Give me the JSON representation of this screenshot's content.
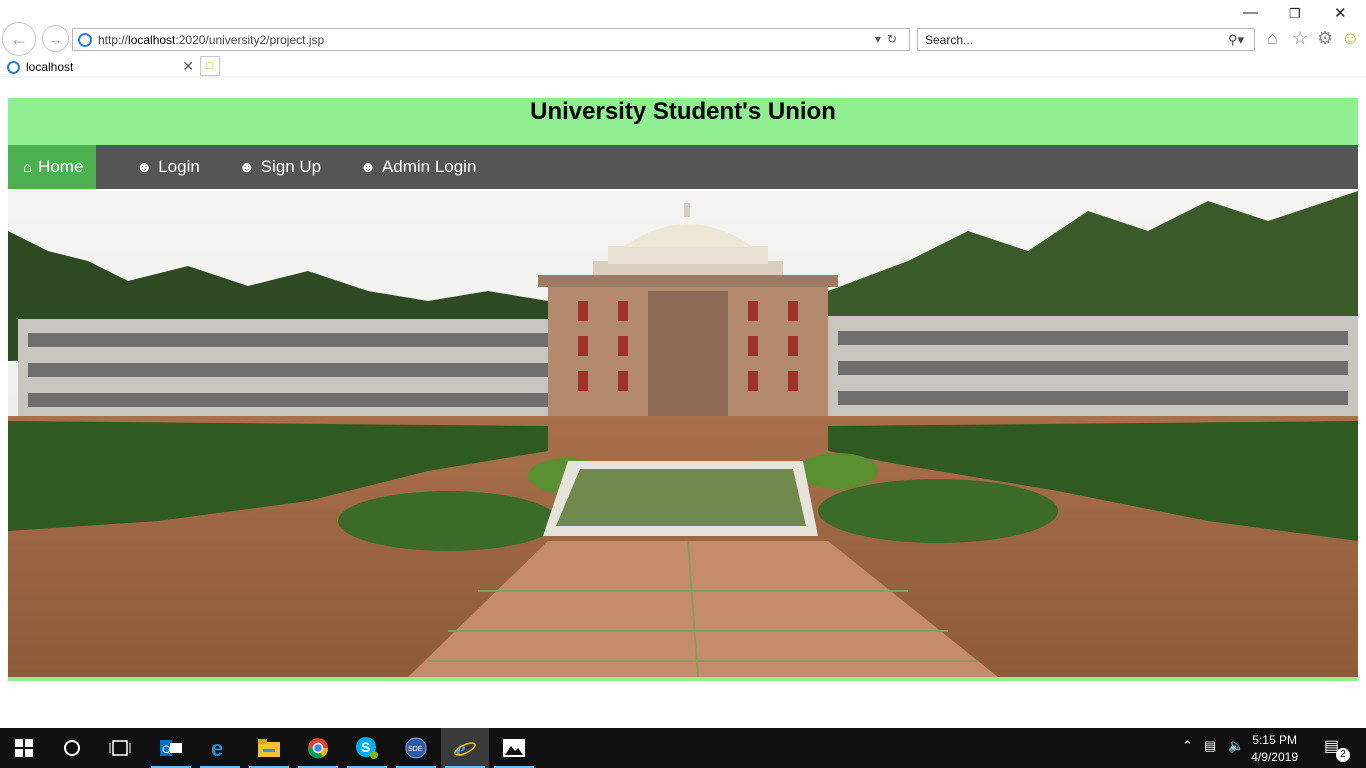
{
  "browser": {
    "address_prefix": "http://",
    "address_host": "localhost",
    "address_rest": ":2020/university2/project.jsp",
    "search_placeholder": "Search...",
    "tab_title": "localhost"
  },
  "page": {
    "title": "University Student's Union",
    "nav": [
      {
        "label": "Home",
        "icon": "home-icon"
      },
      {
        "label": "Login",
        "icon": "user-icon"
      },
      {
        "label": "Sign Up",
        "icon": "user-icon"
      },
      {
        "label": "Admin Login",
        "icon": "user-icon"
      }
    ],
    "colors": {
      "header": "#90ee90",
      "nav": "#555555",
      "active": "#4caf50"
    }
  },
  "taskbar": {
    "time": "5:15 PM",
    "date": "4/9/2019",
    "notifications": "2",
    "apps": [
      "outlook-icon",
      "edge-icon",
      "file-explorer-icon",
      "chrome-icon",
      "skype-icon",
      "sde-icon",
      "internet-explorer-icon",
      "photos-icon"
    ]
  }
}
